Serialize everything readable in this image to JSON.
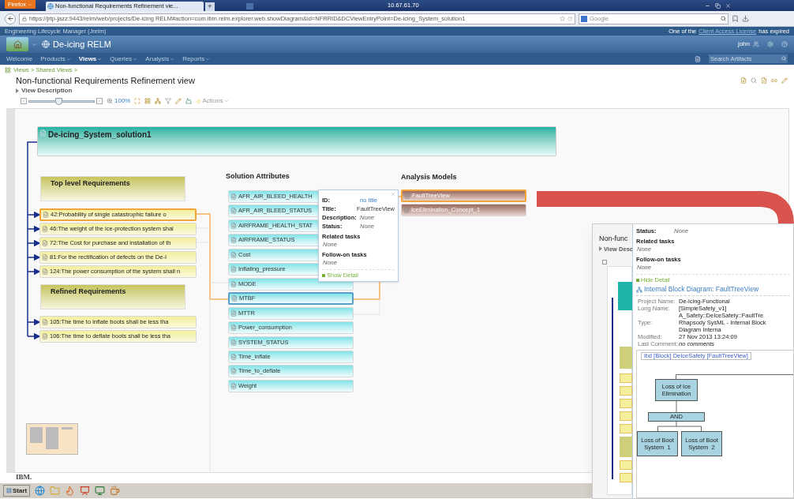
{
  "browser": {
    "menu_button": "Firefox",
    "tab_title": "Non-functional Requirements Refinement vie...",
    "new_tab": "+",
    "window_title": "10.67.61.70",
    "url": "https://jrtp-jazz:9443/relm/web/projects/De-icing RELM#action=com.ibm.relm.explorer.web.showDiagram&id=NFRRID&DCViewEntryPoint=De-icing_System_solution1",
    "search_placeholder": "Google"
  },
  "app": {
    "product": "Engineering Lifecycle Manager (Jrelm)",
    "notice": "One of the",
    "notice_link": "Client Access License",
    "notice_end": "has expired",
    "project": "De-icing RELM",
    "user": "john",
    "nav": [
      {
        "label": "Welcome",
        "selected": false,
        "menu": false
      },
      {
        "label": "Products",
        "selected": false,
        "menu": true
      },
      {
        "label": "Views",
        "selected": true,
        "menu": true
      },
      {
        "label": "Queries",
        "selected": false,
        "menu": true
      },
      {
        "label": "Analysis",
        "selected": false,
        "menu": true
      },
      {
        "label": "Reports",
        "selected": false,
        "menu": true
      }
    ],
    "search_placeholder": "Search Artifacts"
  },
  "page": {
    "breadcrumb": "Views > Shared Views >",
    "title": "Non-functional Requirements Refinement view",
    "description_toggle": "View Description",
    "zoom_slider": {
      "level": 0.45
    },
    "zoom": "100%",
    "actions": "Actions"
  },
  "diagram": {
    "root": "De-icing_System_solution1",
    "groups": [
      {
        "title": "Top level Requirements",
        "items": [
          {
            "label": "42:Probability of single catastrophic failure o",
            "selected": true
          },
          {
            "label": "46:The weight of the ice-protection system shal",
            "selected": false
          },
          {
            "label": "72:The Cost for purchase and installation of th",
            "selected": false
          },
          {
            "label": "81:For the rectification of defects on the De-I",
            "selected": false
          },
          {
            "label": "124:The power consumption of the system shall n",
            "selected": false
          }
        ]
      },
      {
        "title": "Refined Requirements",
        "items": [
          {
            "label": "105:The time to inflate boots shall be less tha",
            "selected": false
          },
          {
            "label": "106:The time to deflate boots shall be less tha",
            "selected": false
          }
        ]
      }
    ],
    "attributes_title": "Solution Attributes",
    "attributes": [
      {
        "label": "AFR_AIR_BLEED_HEALTH",
        "selected": false
      },
      {
        "label": "AFR_AIR_BLEED_STATUS",
        "selected": false
      },
      {
        "label": "AIRFRAME_HEALTH_STAT",
        "selected": false
      },
      {
        "label": "AIRFRAME_STATUS",
        "selected": false
      },
      {
        "label": "Cost",
        "selected": false
      },
      {
        "label": "Inflating_pressure",
        "selected": false
      },
      {
        "label": "MODE",
        "selected": false
      },
      {
        "label": "MTBF",
        "selected": true
      },
      {
        "label": "MTTR",
        "selected": false
      },
      {
        "label": "Power_consumption",
        "selected": false
      },
      {
        "label": "SYSTEM_STATUS",
        "selected": false
      },
      {
        "label": "Time_inflate",
        "selected": false
      },
      {
        "label": "Time_to_deflate",
        "selected": false
      },
      {
        "label": "Weight",
        "selected": false
      }
    ],
    "models_title": "Analysis Models",
    "models": [
      {
        "label": "FaultTreeView",
        "selected": true
      },
      {
        "label": "IceElimination_Concept_1",
        "selected": false
      }
    ],
    "popup": {
      "fields": [
        {
          "kind": "inline",
          "label": "ID:",
          "value": "no title",
          "link": true
        },
        {
          "kind": "inline",
          "label": "Title:",
          "value": "FaultTreeView",
          "link": false
        },
        {
          "kind": "inline",
          "label": "Description:",
          "value": "None",
          "link": false
        },
        {
          "kind": "inline",
          "label": "Status:",
          "value": "None",
          "link": false
        },
        {
          "kind": "block",
          "label": "Related tasks",
          "value": "None",
          "link": false
        },
        {
          "kind": "block",
          "label": "Follow-on tasks",
          "value": "None",
          "link": false
        }
      ],
      "toggle": "Show Detail"
    }
  },
  "inset": {
    "title": "Non-func",
    "description_toggle": "View Desc",
    "fields": [
      {
        "kind": "inline",
        "label": "Status:",
        "value": "None",
        "link": false
      },
      {
        "kind": "block",
        "label": "Related tasks",
        "value": "None",
        "link": false
      },
      {
        "kind": "block",
        "label": "Follow-on tasks",
        "value": "None",
        "link": false
      }
    ],
    "toggle": "Hide Detail",
    "detail_title": "Internal Block Diagram: FaultTreeView",
    "properties": [
      {
        "label": "Project Name:",
        "value": "De-icing-Functional"
      },
      {
        "label": "Long Name:",
        "value": "[SimpleSafety_v1] A_Safety::DeIceSafety::FaultTre"
      },
      {
        "label": "Type:",
        "value": "Rhapsody SysML - Internal Block Diagram Interna"
      },
      {
        "label": "Modified:",
        "value": "27 Nov 2013 13:24:09"
      },
      {
        "label": "Last Comment:",
        "value": "no comments"
      }
    ],
    "diagram_tab": "ibd [Block] DeIceSafety [FaultTreeView]",
    "fault_tree": {
      "top": "Loss of Ice Elimination",
      "gate": "AND",
      "children": [
        "Loss of Boot System  1",
        "Loss of Boot System  2"
      ]
    }
  },
  "footer": {
    "brand": "IBM."
  },
  "taskbar": {
    "start": "Start"
  }
}
